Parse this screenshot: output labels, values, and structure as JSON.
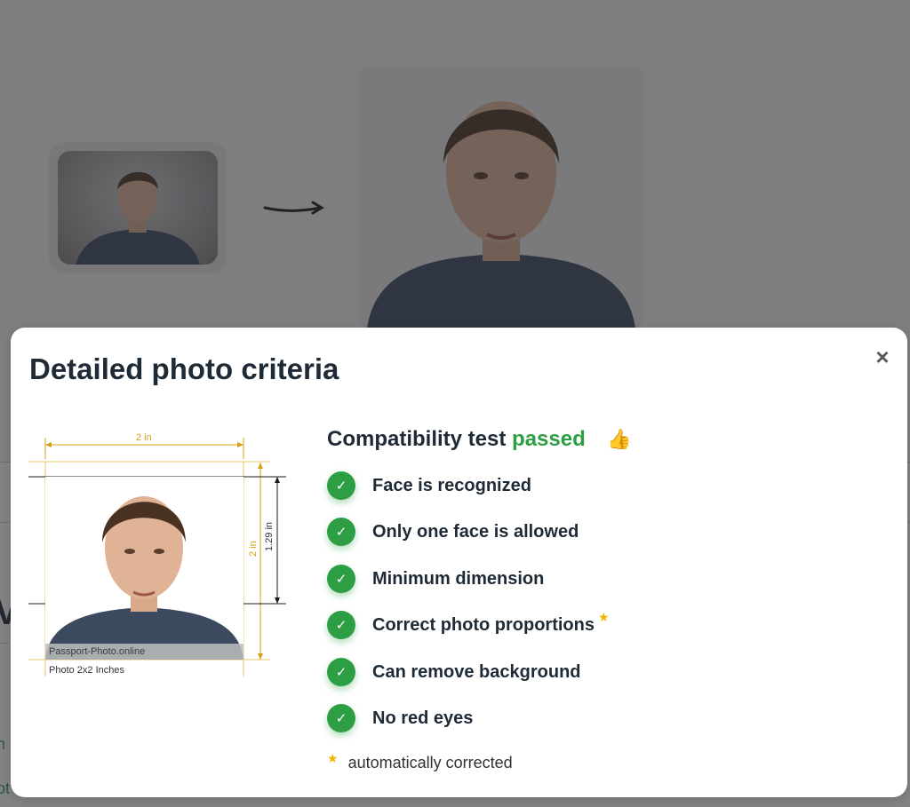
{
  "modal": {
    "title": "Detailed photo criteria",
    "close_symbol": "×"
  },
  "diagram": {
    "width_label": "2 in",
    "height_label": "2 in",
    "head_label": "1.29 in",
    "watermark": "Passport-Photo.online",
    "caption": "Photo 2x2 Inches"
  },
  "criteria": {
    "title_prefix": "Compatibility test",
    "title_status": "passed",
    "thumb_icon": "thumbs-up-icon",
    "items": [
      {
        "label": "Face is recognized",
        "corrected": false
      },
      {
        "label": "Only one face is allowed",
        "corrected": false
      },
      {
        "label": "Minimum dimension",
        "corrected": false
      },
      {
        "label": "Correct photo proportions",
        "corrected": true
      },
      {
        "label": "Can remove background",
        "corrected": false
      },
      {
        "label": "No red eyes",
        "corrected": false
      }
    ],
    "star_symbol": "★",
    "footnote": "automatically corrected"
  },
  "colors": {
    "accent_green": "#2e9e44",
    "star_yellow": "#f2b200",
    "dimension_gold": "#d4a017",
    "text_dark": "#1f2a37"
  }
}
